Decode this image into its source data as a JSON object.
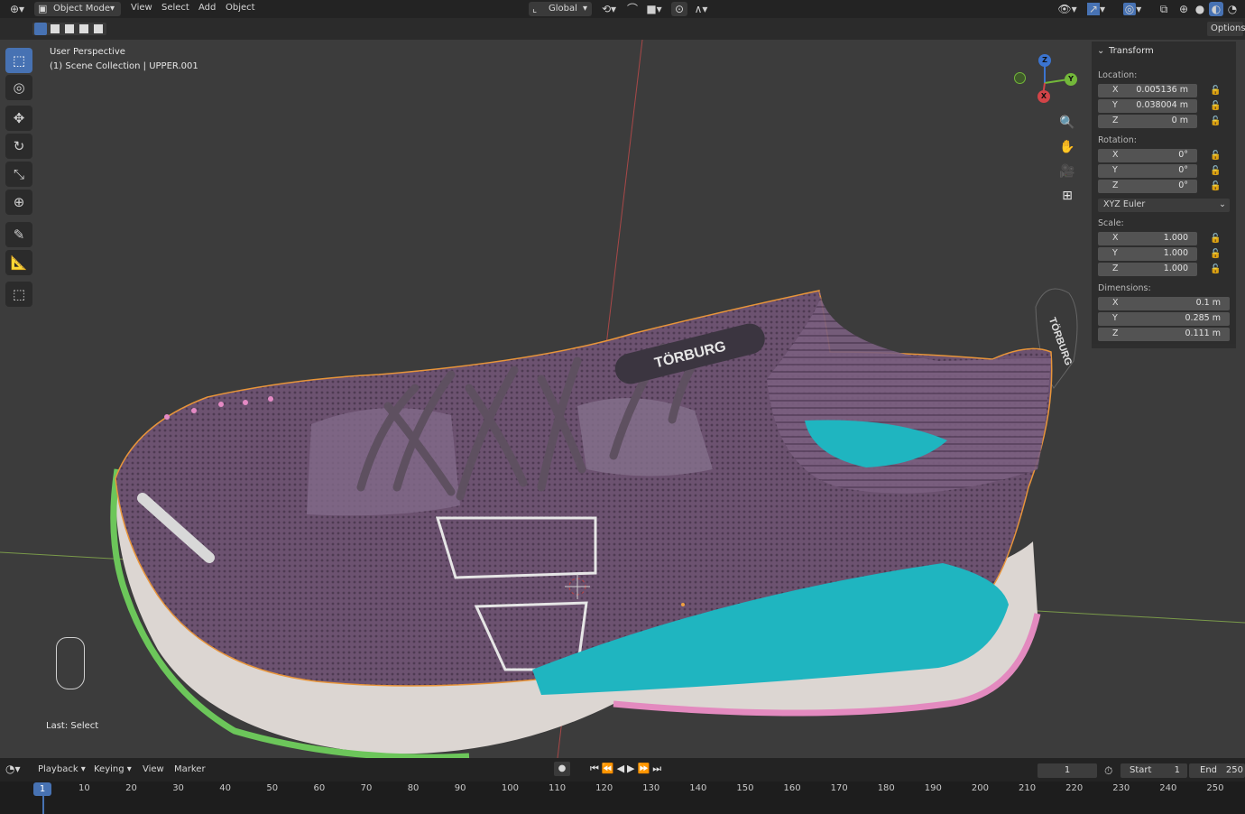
{
  "header": {
    "mode_label": "Object Mode",
    "menus": [
      "View",
      "Select",
      "Add",
      "Object"
    ],
    "transform_orientation": "Global",
    "options_label": "Options"
  },
  "viewport": {
    "perspective_label": "User Perspective",
    "collection_label": "(1) Scene Collection | UPPER.001",
    "last_operation": "Last: Select",
    "logo_text": "TÖRBURG",
    "gizmo": {
      "x": "X",
      "y": "Y",
      "z": "Z"
    }
  },
  "toolbar": {
    "tools": [
      "select-box",
      "cursor",
      "move",
      "rotate",
      "scale",
      "transform",
      "annotate",
      "measure",
      "add-cube"
    ]
  },
  "transform_panel": {
    "title": "Transform",
    "location_label": "Location:",
    "location": [
      {
        "axis": "X",
        "value": "0.005136 m"
      },
      {
        "axis": "Y",
        "value": "0.038004 m"
      },
      {
        "axis": "Z",
        "value": "0 m"
      }
    ],
    "rotation_label": "Rotation:",
    "rotation": [
      {
        "axis": "X",
        "value": "0°"
      },
      {
        "axis": "Y",
        "value": "0°"
      },
      {
        "axis": "Z",
        "value": "0°"
      }
    ],
    "rotation_mode": "XYZ Euler",
    "scale_label": "Scale:",
    "scale": [
      {
        "axis": "X",
        "value": "1.000"
      },
      {
        "axis": "Y",
        "value": "1.000"
      },
      {
        "axis": "Z",
        "value": "1.000"
      }
    ],
    "dimensions_label": "Dimensions:",
    "dimensions": [
      {
        "axis": "X",
        "value": "0.1 m"
      },
      {
        "axis": "Y",
        "value": "0.285 m"
      },
      {
        "axis": "Z",
        "value": "0.111 m"
      }
    ]
  },
  "timeline": {
    "menus": [
      "Playback",
      "Keying",
      "View",
      "Marker"
    ],
    "current_frame": "1",
    "start_label": "Start",
    "start_value": "1",
    "end_label": "End",
    "end_value": "250",
    "ticks": [
      "10",
      "20",
      "30",
      "40",
      "50",
      "60",
      "70",
      "80",
      "90",
      "100",
      "110",
      "120",
      "130",
      "140",
      "150",
      "160",
      "170",
      "180",
      "190",
      "200",
      "210",
      "220",
      "230",
      "240",
      "250"
    ]
  },
  "colors": {
    "accent": "#4772b3",
    "upper": "#6e5470",
    "teal": "#1fb5c0",
    "outline": "#e8953a"
  }
}
